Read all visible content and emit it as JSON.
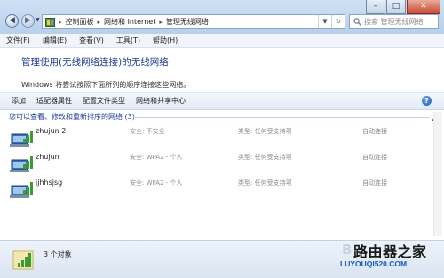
{
  "address": {
    "crumbs": [
      "控制面板",
      "网络和 Internet",
      "管理无线网络"
    ],
    "search_placeholder": "搜索 管理无线网络"
  },
  "window_controls": {
    "minimize": "–",
    "maximize": "□",
    "close": "✕"
  },
  "menu": [
    "文件(F)",
    "编辑(E)",
    "查看(V)",
    "工具(T)",
    "帮助(H)"
  ],
  "page": {
    "title": "管理使用(无线网络连接)的无线网络",
    "description": "Windows 将尝试按照下面所列的顺序连接这些网络。"
  },
  "toolbar": [
    "添加",
    "适配器属性",
    "配置文件类型",
    "网络和共享中心"
  ],
  "group_header": "您可以查看、修改和重新排序的网络 (3)",
  "networks": [
    {
      "name": "zhujun 2",
      "security": "安全: 不安全",
      "type": "类型: 任何受支持项",
      "mode": "自动连接"
    },
    {
      "name": "zhujun",
      "security": "安全: WPA2 - 个人",
      "type": "类型: 任何受支持项",
      "mode": "自动连接"
    },
    {
      "name": "jjhhsjsg",
      "security": "安全: WPA2 - 个人",
      "type": "类型: 任何受支持项",
      "mode": "自动连接"
    }
  ],
  "status": {
    "count_text": "3 个对象"
  },
  "watermark": {
    "title": "路由器之家",
    "url": "LUYOUQI520.COM",
    "partial": "B"
  },
  "icons": [
    "back-icon",
    "forward-icon",
    "control-panel-icon",
    "search-icon",
    "wireless-network-icon",
    "signal-bars-icon",
    "help-icon"
  ],
  "colors": {
    "title_blue": "#1e3c96",
    "chrome": "#cfe1f4",
    "watermark_url": "#1457c9"
  }
}
